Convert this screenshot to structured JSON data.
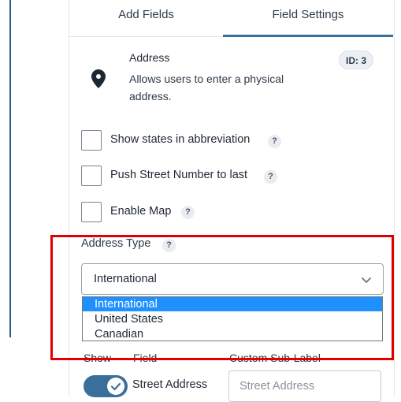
{
  "tabs": {
    "add_fields": "Add Fields",
    "field_settings": "Field Settings"
  },
  "field": {
    "title": "Address",
    "description": "Allows users to enter a physical address.",
    "id_badge": "ID: 3",
    "icon": "map-pin-icon"
  },
  "options": [
    {
      "label": "Show states in abbreviation",
      "checked": false
    },
    {
      "label": "Push Street Number to last",
      "checked": false
    },
    {
      "label": "Enable Map",
      "checked": false
    }
  ],
  "help_glyph": "?",
  "address_type": {
    "label": "Address Type",
    "selected": "International",
    "dropdown_open": true,
    "choices": [
      "International",
      "United States",
      "Canadian"
    ]
  },
  "subfields": {
    "headers": {
      "show": "Show",
      "field": "Field",
      "custom_sub_label": "Custom Sub-Label"
    },
    "rows": [
      {
        "show": true,
        "field": "Street Address",
        "placeholder": "Street Address"
      }
    ]
  },
  "colors": {
    "accent": "#3b6f9b",
    "highlight": "#e00000",
    "selected_option": "#1e90ff"
  }
}
